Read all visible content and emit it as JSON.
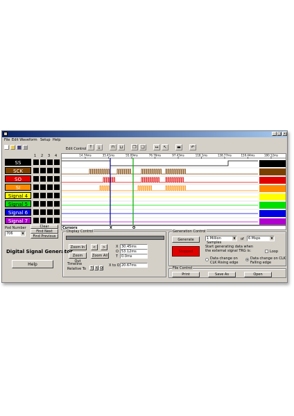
{
  "menu": [
    "File",
    "Edit Waveform",
    "Setup",
    "Help"
  ],
  "toolbar": {
    "edit_control_label": "Edit Control"
  },
  "pod_headers": [
    "1",
    "2",
    "3",
    "4"
  ],
  "signals": [
    {
      "name": "SS",
      "bg": "#000000",
      "fg": "#ffffff"
    },
    {
      "name": "SCK",
      "bg": "#7b3f00",
      "fg": "#ffffff"
    },
    {
      "name": "SO",
      "bg": "#e00000",
      "fg": "#ffffff"
    },
    {
      "name": "SI",
      "bg": "#ff8c00",
      "fg": "#ffffff"
    },
    {
      "name": "Signal 4",
      "bg": "#ffff00",
      "fg": "#000000"
    },
    {
      "name": "Signal 5",
      "bg": "#00e000",
      "fg": "#000000"
    },
    {
      "name": "Signal 6",
      "bg": "#0000e0",
      "fg": "#ffffff"
    },
    {
      "name": "Signal 7",
      "bg": "#b000d0",
      "fg": "#ffffff"
    }
  ],
  "timeline_ticks": [
    "14.74ms",
    "35.41ms",
    "55.09ms",
    "76.76ms",
    "97.43ms",
    "118.1ms",
    "138.77ms",
    "159.44ms",
    "180.12ms"
  ],
  "cursors_label": "Cursors",
  "cursor_x_label": "X",
  "cursor_o_label": "O",
  "left_panel": {
    "pod_number_label": "Pod Number",
    "pod_number_value": "706",
    "clear_label": "Clear",
    "find_next_label": "Find Next",
    "find_previous_label": "Find Previous",
    "app_title": "Digital Signal Generator",
    "help_label": "Help"
  },
  "display_control": {
    "title": "Display Control",
    "zoom_in": "Zoom In",
    "zoom_out": "Zoom Out",
    "zoom_all": "Zoom All",
    "left_arrow": "<",
    "right_arrow": ">",
    "x_label": "X",
    "o_label": "O",
    "t_label": "T",
    "x_value": "30.45ms",
    "o_value": "53.12ms",
    "t_value": "0.0ms",
    "timeline_label": "Timeline",
    "relative_to_label": "Relative To",
    "relative_options": [
      "T",
      "X",
      "O"
    ],
    "x_to_o_label": "X to O",
    "x_to_o_value": "20.67ms"
  },
  "generation_control": {
    "title": "Generation Control",
    "generate_label": "Generate",
    "samples_value": "1 Million Samples",
    "of_label": "of",
    "rate_value": "6 Msps",
    "stopped_label": "Stopped",
    "trigger_text": "Start generating data when the external signal TRG is:",
    "loop_label": "Loop",
    "rising_label": "Data change on CLK Rising edge",
    "falling_label": "Data change on CLK Falling edge"
  },
  "file_control": {
    "title": "File Control",
    "print_label": "Print",
    "save_as_label": "Save As",
    "open_label": "Open"
  },
  "colors": {
    "cursor_x": "#00008b",
    "cursor_o": "#00aa00",
    "stopped_bg": "#e00000"
  }
}
